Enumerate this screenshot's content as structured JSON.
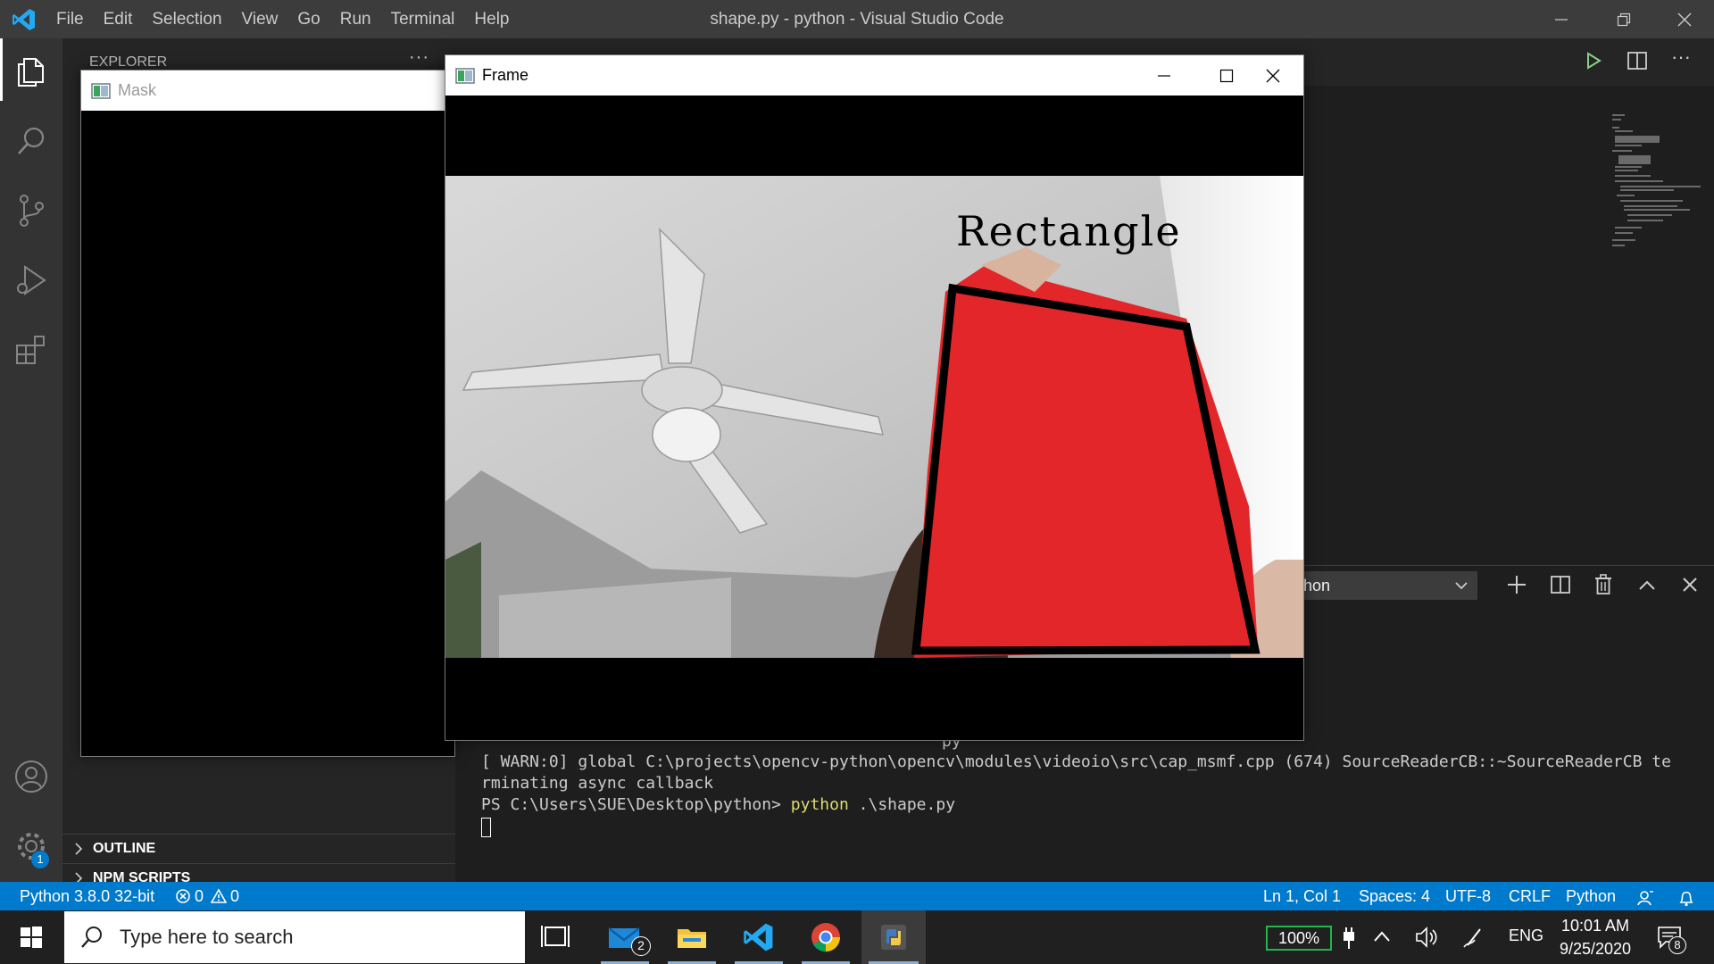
{
  "menu": {
    "items": [
      "File",
      "Edit",
      "Selection",
      "View",
      "Go",
      "Run",
      "Terminal",
      "Help"
    ],
    "window_title": "shape.py - python - Visual Studio Code"
  },
  "sidebar": {
    "header": "EXPLORER",
    "sections": [
      "OUTLINE",
      "NPM SCRIPTS"
    ]
  },
  "mask_window": {
    "title": "Mask"
  },
  "frame_window": {
    "title": "Frame",
    "overlay_label": "Rectangle"
  },
  "panel": {
    "dropdown_value": "hon",
    "terminal": {
      "stub": "py",
      "warn_line1": "[ WARN:0] global C:\\projects\\opencv-python\\opencv\\modules\\videoio\\src\\cap_msmf.cpp (674) SourceReaderCB::~SourceReaderCB te",
      "warn_line2": "rminating async callback",
      "prompt": "PS C:\\Users\\SUE\\Desktop\\python>",
      "command": "python",
      "args": " .\\shape.py"
    }
  },
  "statusbar": {
    "interpreter": "Python 3.8.0 32-bit",
    "errors": "0",
    "warnings": "0",
    "position": "Ln 1, Col 1",
    "spaces": "Spaces: 4",
    "encoding": "UTF-8",
    "eol": "CRLF",
    "language": "Python"
  },
  "activitybar": {
    "settings_badge": "1"
  },
  "taskbar": {
    "search_placeholder": "Type here to search",
    "mail_badge": "2",
    "battery": "100%",
    "language": "ENG",
    "time": "10:01 AM",
    "date": "9/25/2020",
    "notification_count": "8"
  },
  "colors": {
    "accent": "#007acc",
    "titlebar": "#3c3c3c",
    "activitybar": "#333333",
    "sidebar": "#252526",
    "editor": "#1e1e1e",
    "taskbar": "#202020",
    "red_object": "#e3262a",
    "terminal_command": "#dcdc6e"
  }
}
